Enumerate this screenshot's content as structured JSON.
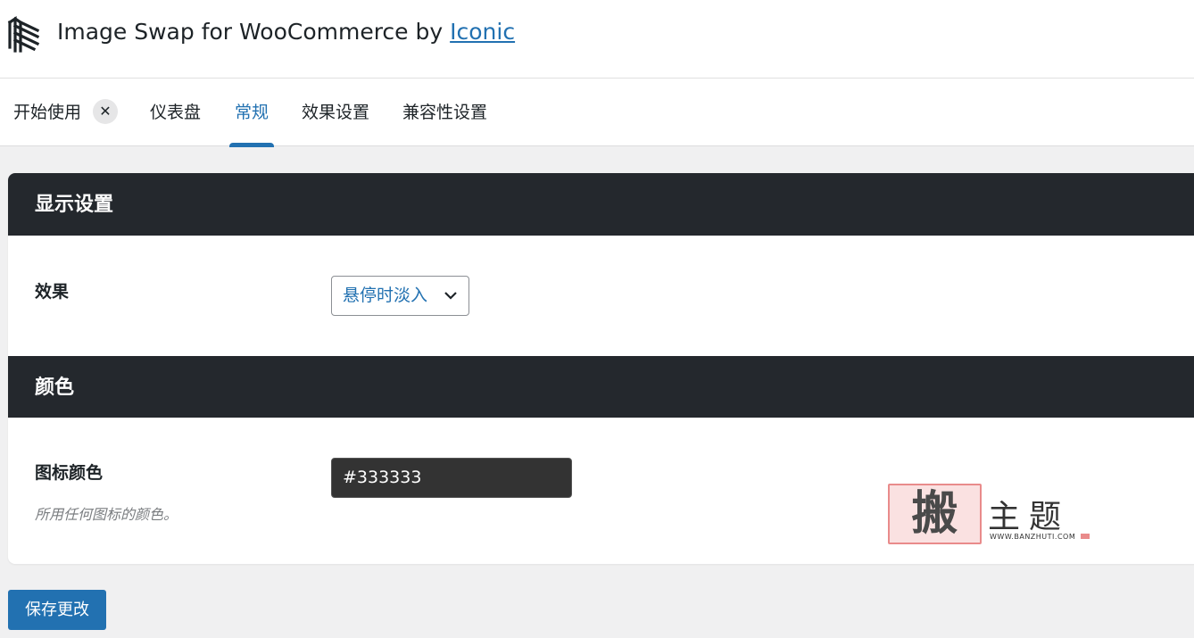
{
  "header": {
    "title_prefix": "Image Swap for WooCommerce by ",
    "title_link": "Iconic",
    "logo_icon": "iconic-logo-icon"
  },
  "tabs": [
    {
      "label": "开始使用",
      "closable": true
    },
    {
      "label": "仪表盘"
    },
    {
      "label": "常规",
      "active": true
    },
    {
      "label": "效果设置"
    },
    {
      "label": "兼容性设置"
    }
  ],
  "close_icon": "✕",
  "sections": {
    "display": {
      "title": "显示设置",
      "effect_label": "效果",
      "effect_value": "悬停时淡入"
    },
    "color": {
      "title": "颜色",
      "icon_color_label": "图标颜色",
      "icon_color_desc": "所用任何图标的颜色。",
      "icon_color_value": "#333333"
    }
  },
  "watermark": {
    "stamp": "搬",
    "text": "主题",
    "url": "WWW.BANZHUTI.COM"
  },
  "save_label": "保存更改",
  "colors": {
    "accent": "#2271b1",
    "section_header": "#24282d",
    "icon_swatch": "#333333"
  }
}
